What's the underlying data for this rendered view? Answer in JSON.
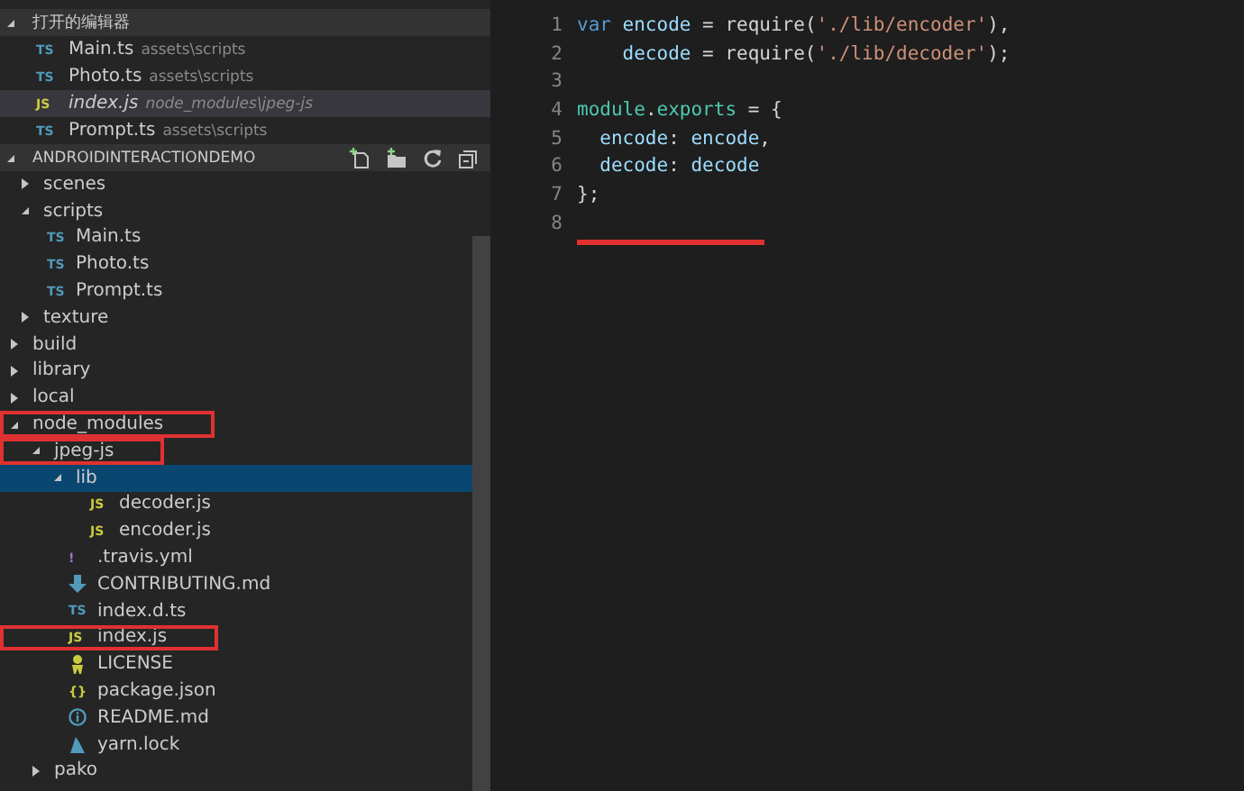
{
  "open_editors": {
    "title": "打开的编辑器",
    "expanded": true,
    "items": [
      {
        "badge": "TS",
        "color": "#519aba",
        "name": "Main.ts",
        "path": "assets\\scripts",
        "selected": false
      },
      {
        "badge": "TS",
        "color": "#519aba",
        "name": "Photo.ts",
        "path": "assets\\scripts",
        "selected": false
      },
      {
        "badge": "JS",
        "color": "#cbcb41",
        "name": "index.js",
        "path": "node_modules\\jpeg-js",
        "selected": true
      },
      {
        "badge": "TS",
        "color": "#519aba",
        "name": "Prompt.ts",
        "path": "assets\\scripts",
        "selected": false
      }
    ]
  },
  "explorer": {
    "title": "ANDROIDINTERACTIONDEMO",
    "expanded": true,
    "tree": [
      {
        "kind": "folder",
        "name": "scenes",
        "expanded": false,
        "selected": false,
        "highlighted": false,
        "indent_parent": true
      },
      {
        "kind": "folder",
        "name": "scripts",
        "expanded": true,
        "selected": false,
        "highlighted": false,
        "indent_parent": true,
        "children": [
          {
            "kind": "badge-file",
            "badge": "TS",
            "color": "#519aba",
            "name": "Main.ts",
            "selected": false,
            "highlighted": false
          },
          {
            "kind": "badge-file",
            "badge": "TS",
            "color": "#519aba",
            "name": "Photo.ts",
            "selected": false,
            "highlighted": false
          },
          {
            "kind": "badge-file",
            "badge": "TS",
            "color": "#519aba",
            "name": "Prompt.ts",
            "selected": false,
            "highlighted": false
          }
        ]
      },
      {
        "kind": "folder",
        "name": "texture",
        "expanded": false,
        "selected": false,
        "highlighted": false,
        "indent_parent": true
      },
      {
        "kind": "folder",
        "name": "build",
        "expanded": false,
        "selected": false,
        "highlighted": false
      },
      {
        "kind": "folder",
        "name": "library",
        "expanded": false,
        "selected": false,
        "highlighted": false
      },
      {
        "kind": "folder",
        "name": "local",
        "expanded": false,
        "selected": false,
        "highlighted": false
      },
      {
        "kind": "folder",
        "name": "node_modules",
        "expanded": true,
        "selected": false,
        "highlighted": true,
        "children": [
          {
            "kind": "folder",
            "name": "jpeg-js",
            "expanded": true,
            "selected": false,
            "highlighted": true,
            "children": [
              {
                "kind": "folder",
                "name": "lib",
                "expanded": true,
                "selected": true,
                "highlighted": false,
                "children": [
                  {
                    "kind": "badge-file",
                    "badge": "JS",
                    "color": "#cbcb41",
                    "name": "decoder.js",
                    "selected": false,
                    "highlighted": false
                  },
                  {
                    "kind": "badge-file",
                    "badge": "JS",
                    "color": "#cbcb41",
                    "name": "encoder.js",
                    "selected": false,
                    "highlighted": false
                  }
                ]
              },
              {
                "kind": "badge-file",
                "badge": "!",
                "color": "#a074c4",
                "name": ".travis.yml",
                "selected": false,
                "highlighted": false
              },
              {
                "kind": "arrow-file",
                "name": "CONTRIBUTING.md",
                "selected": false,
                "highlighted": false
              },
              {
                "kind": "badge-file",
                "badge": "TS",
                "color": "#519aba",
                "name": "index.d.ts",
                "selected": false,
                "highlighted": false
              },
              {
                "kind": "badge-file",
                "badge": "JS",
                "color": "#cbcb41",
                "name": "index.js",
                "selected": false,
                "highlighted": true
              },
              {
                "kind": "license-file",
                "name": "LICENSE",
                "selected": false,
                "highlighted": false
              },
              {
                "kind": "badge-file",
                "badge": "{}",
                "color": "#cbcb41",
                "name": "package.json",
                "selected": false,
                "highlighted": false
              },
              {
                "kind": "info-file",
                "name": "README.md",
                "selected": false,
                "highlighted": false
              },
              {
                "kind": "yarn-file",
                "name": "yarn.lock",
                "selected": false,
                "highlighted": false
              }
            ]
          },
          {
            "kind": "folder",
            "name": "pako",
            "expanded": false,
            "selected": false,
            "highlighted": false
          }
        ]
      }
    ]
  },
  "editor": {
    "lines": [
      {
        "number": "1",
        "underlined": false,
        "tokens": [
          {
            "kind": "keyword",
            "text": "var"
          },
          {
            "kind": "variable",
            "text": " encode"
          },
          {
            "kind": "plain",
            "text": " = require("
          },
          {
            "kind": "string",
            "text": "'./lib/encoder'"
          },
          {
            "kind": "plain",
            "text": "),"
          }
        ]
      },
      {
        "number": "2",
        "underlined": false,
        "tokens": [
          {
            "kind": "variable",
            "text": "    decode"
          },
          {
            "kind": "plain",
            "text": " = require("
          },
          {
            "kind": "string",
            "text": "'./lib/decoder'"
          },
          {
            "kind": "plain",
            "text": ");"
          }
        ]
      },
      {
        "number": "3",
        "underlined": false
      },
      {
        "number": "4",
        "underlined": false,
        "tokens": [
          {
            "kind": "type",
            "text": "module"
          },
          {
            "kind": "plain",
            "text": "."
          },
          {
            "kind": "type",
            "text": "exports"
          },
          {
            "kind": "plain",
            "text": " = {"
          }
        ]
      },
      {
        "number": "5",
        "underlined": false,
        "tokens": [
          {
            "kind": "variable",
            "text": "  encode"
          },
          {
            "kind": "plain",
            "text": ": "
          },
          {
            "kind": "variable",
            "text": "encode"
          },
          {
            "kind": "plain",
            "text": ","
          }
        ]
      },
      {
        "number": "6",
        "underlined": false,
        "tokens": [
          {
            "kind": "variable",
            "text": "  decode"
          },
          {
            "kind": "plain",
            "text": ": "
          },
          {
            "kind": "variable",
            "text": "decode"
          }
        ]
      },
      {
        "number": "7",
        "underlined": false,
        "tokens": [
          {
            "kind": "plain",
            "text": "};"
          }
        ]
      },
      {
        "number": "8",
        "underlined": true
      }
    ]
  }
}
